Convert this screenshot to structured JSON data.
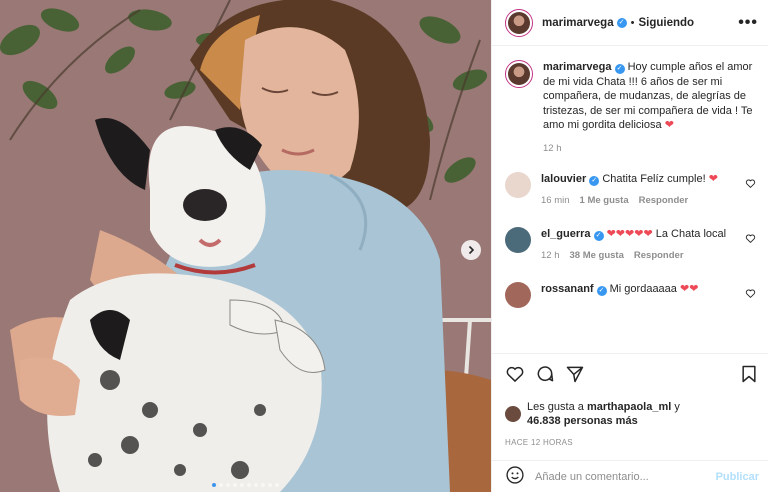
{
  "post": {
    "photo_alt": "",
    "carousel": {
      "total": 10,
      "active": 0
    }
  },
  "header": {
    "username": "marimarvega",
    "separator": "•",
    "follow_status": "Siguiendo",
    "more": "•••"
  },
  "caption": {
    "username": "marimarvega",
    "text": "Hoy cumple años el amor de mi vida Chata !!! 6 años de ser mi compañera, de mudanzas, de alegrías de tristezas, de ser mi compañera de vida ! Te amo mi gordita deliciosa",
    "emoji": "❤",
    "time": "12 h"
  },
  "comments": [
    {
      "username": "lalouvier",
      "text": "Chatita Felíz cumple!",
      "emoji": "❤",
      "time": "16 min",
      "likes": "1 Me gusta",
      "reply": "Responder",
      "avatar_color": "#e9d6cc"
    },
    {
      "username": "el_guerra",
      "text": "La Chata local",
      "emoji": "❤❤❤❤❤",
      "time": "12 h",
      "likes": "38 Me gusta",
      "reply": "Responder",
      "avatar_color": "#4b6a7a"
    },
    {
      "username": "rossananf",
      "text": "Mi gordaaaaa",
      "emoji": "❤❤",
      "time": "",
      "likes": "",
      "reply": "",
      "avatar_color": "#a1675a"
    }
  ],
  "actions": {
    "like_icon": "heart-outline-icon",
    "comment_icon": "comment-bubble-icon",
    "share_icon": "paper-plane-icon",
    "save_icon": "bookmark-icon"
  },
  "likes": {
    "prefix": "Les gusta a",
    "user": "marthapaola_ml",
    "middle": "y",
    "count": "46.838 personas más"
  },
  "posted_ago": "HACE 12 HORAS",
  "add_comment": {
    "placeholder": "Añade un comentario...",
    "publish": "Publicar",
    "emoji_icon": "smiley-icon"
  },
  "colors": {
    "accent": "#3897f0",
    "heart": "#ed4956",
    "muted": "#8e8e8e",
    "publish_disabled": "#b2dffc"
  }
}
